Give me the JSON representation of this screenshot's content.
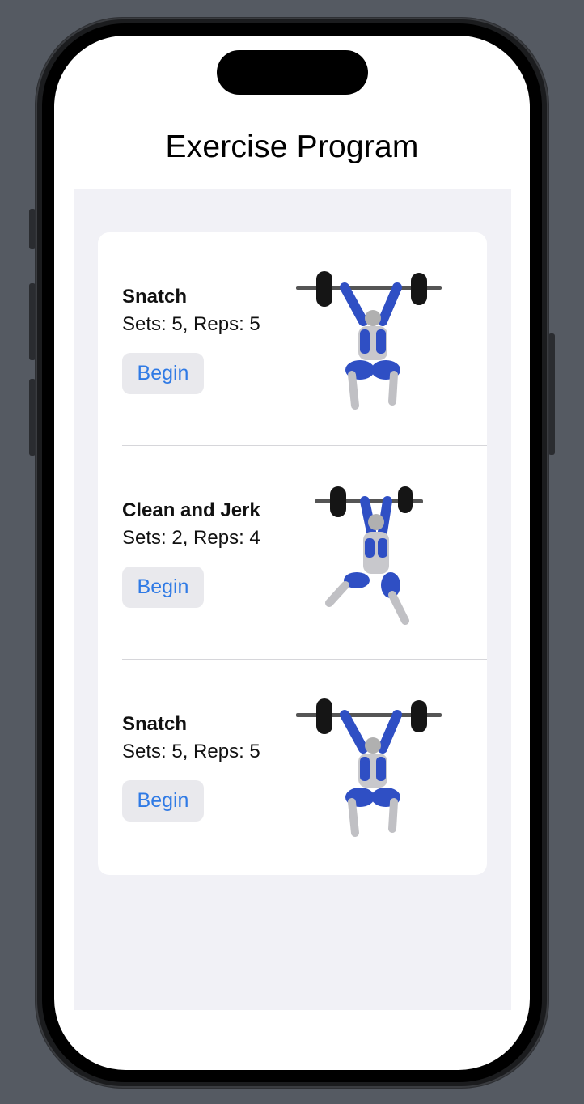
{
  "page": {
    "title": "Exercise Program"
  },
  "exercises": [
    {
      "name": "Snatch",
      "detail": "Sets: 5, Reps: 5",
      "button_label": "Begin",
      "illustration": "overhead-squat-figure"
    },
    {
      "name": "Clean and Jerk",
      "detail": "Sets: 2, Reps: 4",
      "button_label": "Begin",
      "illustration": "split-jerk-figure"
    },
    {
      "name": "Snatch",
      "detail": "Sets: 5, Reps: 5",
      "button_label": "Begin",
      "illustration": "overhead-squat-figure"
    }
  ],
  "colors": {
    "accent": "#2f7ae5",
    "muscle": "#2f4fc4",
    "list_background": "#f1f1f6"
  }
}
